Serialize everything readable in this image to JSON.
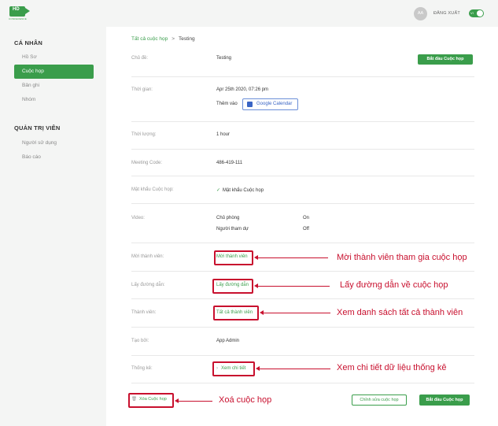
{
  "header": {
    "logo_text": "HD",
    "logo_sub": "CONFERENCE",
    "avatar": "AA",
    "logout": "ĐĂNG XUẤT",
    "lang_toggle": "VI"
  },
  "sidebar": {
    "personal_title": "CÁ NHÂN",
    "personal_items": [
      {
        "label": "Hồ Sơ"
      },
      {
        "label": "Cuộc họp"
      },
      {
        "label": "Bản ghi"
      },
      {
        "label": "Nhóm"
      }
    ],
    "admin_title": "QUẢN TRỊ VIÊN",
    "admin_items": [
      {
        "label": "Người sử dụng"
      },
      {
        "label": "Báo cáo"
      }
    ]
  },
  "breadcrumb": {
    "parent": "Tất cả cuộc họp",
    "separator": ">",
    "current": "Testing"
  },
  "details": {
    "topic_label": "Chủ đề:",
    "topic_value": "Testing",
    "start_button": "Bắt đầu Cuộc họp",
    "time_label": "Thời gian:",
    "time_value": "Apr 25th 2020, 07:26 pm",
    "add_to_label": "Thêm vào",
    "google_calendar": "Google Calendar",
    "duration_label": "Thời lượng:",
    "duration_value": "1 hour",
    "code_label": "Meeting Code:",
    "code_value": "486-419-111",
    "password_label": "Mật khẩu Cuộc họp:",
    "password_value": "Mật khẩu Cuộc họp",
    "video_label": "Video:",
    "host_label": "Chủ phòng",
    "host_value": "On",
    "participant_label": "Người tham dự",
    "participant_value": "Off",
    "invite_label": "Mời thành viên:",
    "invite_link": "Mời thành viên",
    "getlink_label": "Lấy đường dẫn:",
    "getlink_link": "Lấy đường dẫn",
    "members_label": "Thành viên:",
    "members_link": "Tất cả thành viên",
    "created_label": "Tạo bởi:",
    "created_value": "App Admin",
    "stats_label": "Thống kê:",
    "stats_link": "Xem chi tiết",
    "delete_button": "Xóa Cuộc họp",
    "edit_button": "Chỉnh sửa cuộc họp",
    "start_button_bottom": "Bắt đầu Cuộc họp"
  },
  "annotations": {
    "invite": "Mời thành viên tham gia cuộc họp",
    "getlink": "Lấy đường dẫn về cuộc họp",
    "members": "Xem danh sách tất cả thành viên",
    "stats": "Xem chi tiết dữ liệu thống kê",
    "delete": "Xoá cuộc họp"
  },
  "colors": {
    "brand": "#3a9d4b",
    "annotation": "#c8102e"
  }
}
